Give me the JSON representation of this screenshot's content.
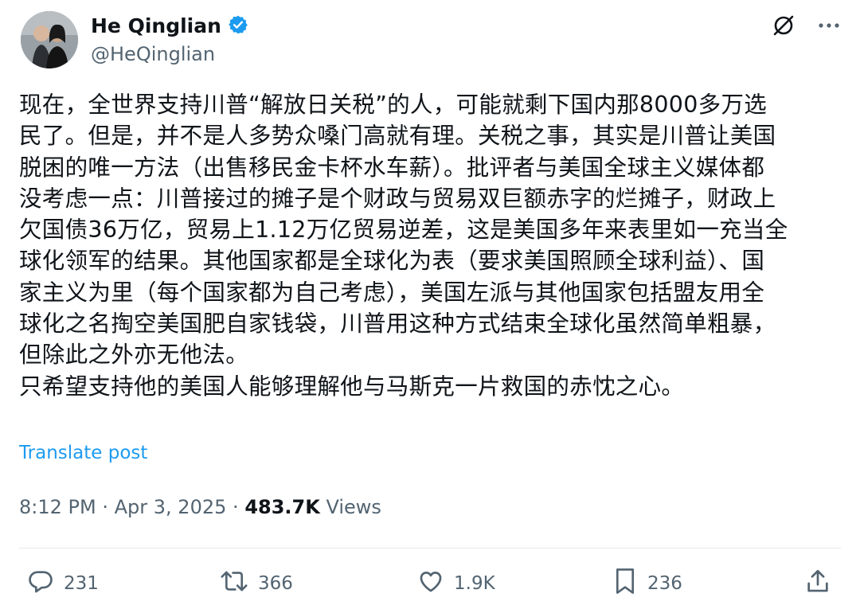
{
  "author": {
    "name": "He Qinglian",
    "handle": "@HeQinglian",
    "verified": true
  },
  "post": {
    "text": "现在，全世界支持川普“解放日关税”的人，可能就剩下国内那8000多万选\n民了。但是，并不是人多势众嗓门高就有理。关税之事，其实是川普让美国\n脱困的唯一方法（出售移民金卡杯水车薪）。批评者与美国全球主义媒体都\n没考虑一点：川普接过的摊子是个财政与贸易双巨额赤字的烂摊子，财政上\n欠国债36万亿，贸易上1.12万亿贸易逆差，这是美国多年来表里如一充当全\n球化领军的结果。其他国家都是全球化为表（要求美国照顾全球利益）、国\n家主义为里（每个国家都为自己考虑），美国左派与其他国家包括盟友用全\n球化之名掏空美国肥自家钱袋，川普用这种方式结束全球化虽然简单粗暴，\n但除此之外亦无他法。\n只希望支持他的美国人能够理解他与马斯克一片救国的赤忱之心。",
    "translate_label": "Translate post",
    "time": "8:12 PM",
    "date": "Apr 3, 2025",
    "separator": "·",
    "views_count": "483.7K",
    "views_label": "Views"
  },
  "actions": {
    "replies": "231",
    "reposts": "366",
    "likes": "1.9K",
    "bookmarks": "236"
  },
  "icons": {
    "verified": "verified-badge-icon",
    "grok": "grok-icon",
    "more": "more-icon",
    "reply": "reply-icon",
    "repost": "repost-icon",
    "like": "like-icon",
    "bookmark": "bookmark-icon",
    "share": "share-icon"
  },
  "colors": {
    "accent": "#1d9bf0",
    "text": "#0f1419",
    "secondary": "#536471"
  }
}
